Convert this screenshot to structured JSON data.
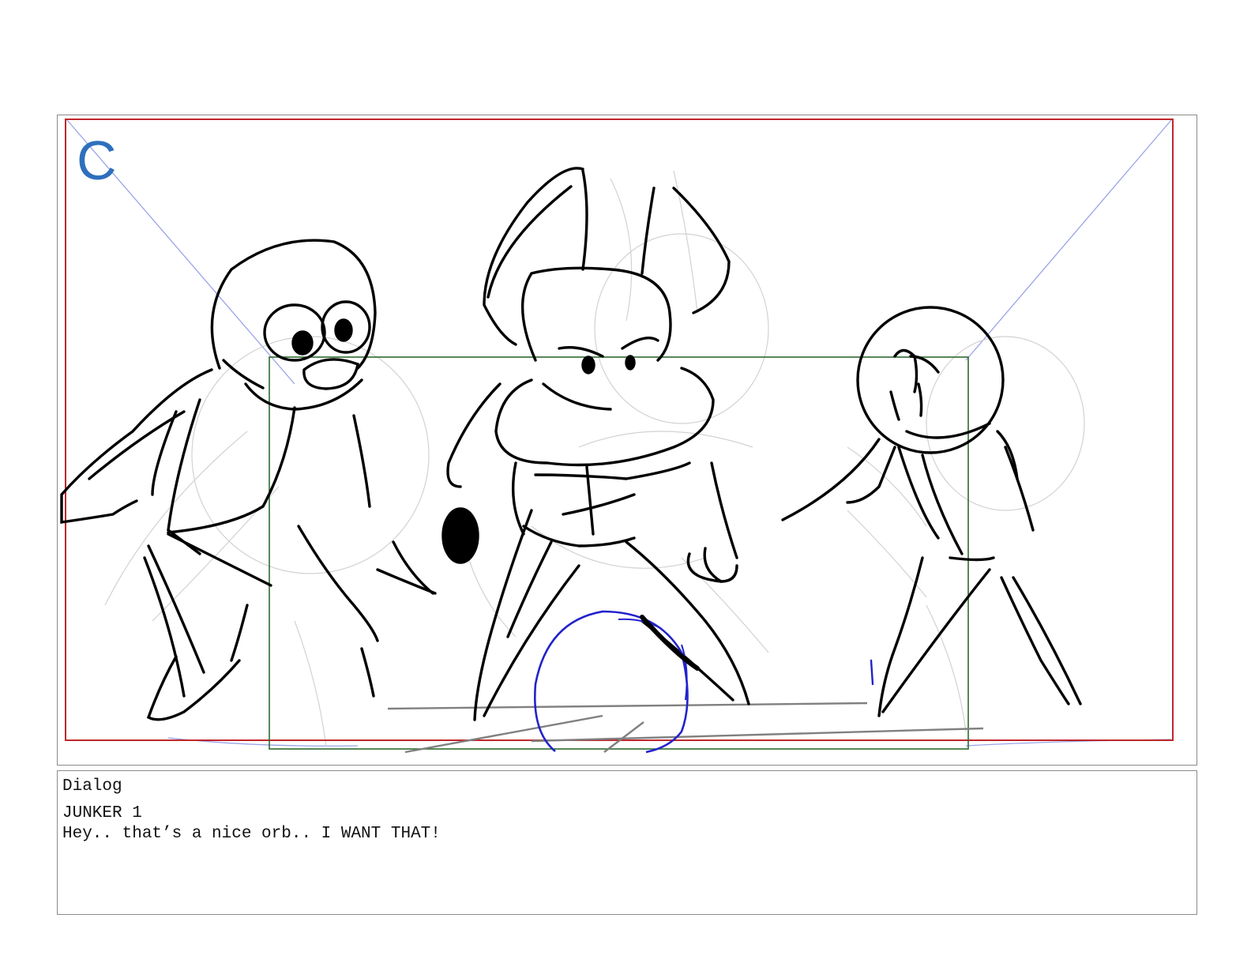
{
  "panel": {
    "letter": "C",
    "colors": {
      "safe_frame": "#c0262b",
      "camera_frame": "#2e6b2e",
      "perspective": "#9aa3e8",
      "orb": "#2222cc",
      "ink": "#000000",
      "rough": "#cfcfcf",
      "ground": "#808080",
      "letter": "#2e6fbd"
    },
    "figures": [
      "character-left",
      "character-center-rabbit",
      "character-right",
      "orb"
    ]
  },
  "dialog": {
    "label": "Dialog",
    "speaker": "JUNKER 1",
    "line": "Hey.. that’s a nice orb.. I WANT THAT!"
  }
}
